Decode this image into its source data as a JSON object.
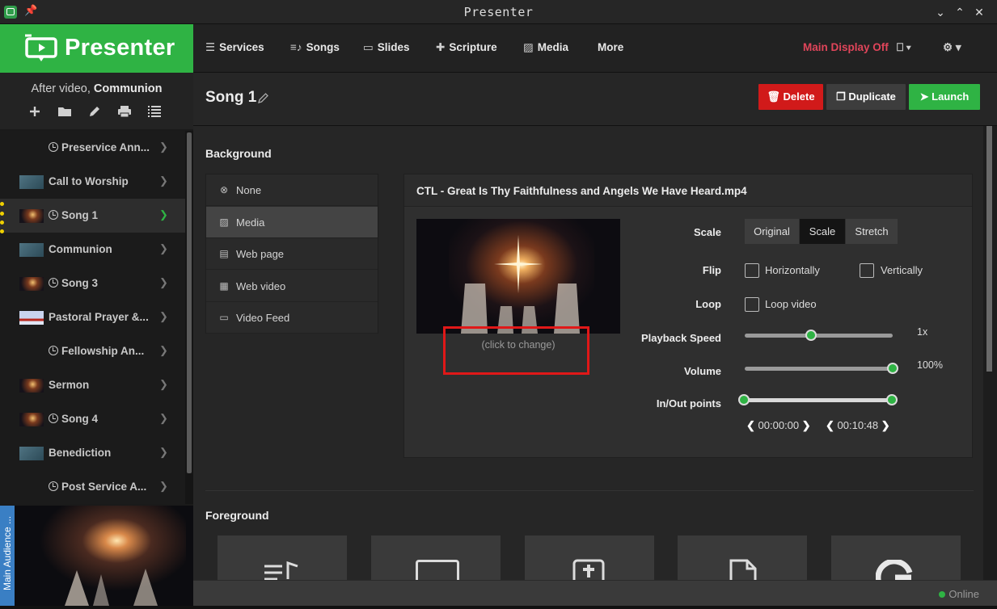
{
  "window": {
    "title": "Presenter",
    "controls": {
      "minimize": "chevron-down-icon",
      "maximize": "chevron-up-icon",
      "close": "close-icon"
    }
  },
  "brand": {
    "name": "Presenter",
    "color": "#2fb344"
  },
  "sidebar": {
    "subtitle_prefix": "After video,",
    "subtitle_current": "Communion",
    "tools": [
      "add-icon",
      "folder-icon",
      "pencil-icon",
      "print-icon",
      "list-icon"
    ],
    "items": [
      {
        "label": "Preservice Ann...",
        "scheduled": true,
        "thumb": "none",
        "active": false
      },
      {
        "label": "Call to Worship",
        "scheduled": false,
        "thumb": "slide",
        "active": false
      },
      {
        "label": "Song 1",
        "scheduled": true,
        "thumb": "video",
        "active": true
      },
      {
        "label": "Communion",
        "scheduled": false,
        "thumb": "slide",
        "active": false
      },
      {
        "label": "Song 3",
        "scheduled": true,
        "thumb": "video",
        "active": false
      },
      {
        "label": "Pastoral Prayer &...",
        "scheduled": false,
        "thumb": "flag",
        "active": false
      },
      {
        "label": "Fellowship An...",
        "scheduled": true,
        "thumb": "none",
        "active": false
      },
      {
        "label": "Sermon",
        "scheduled": false,
        "thumb": "video",
        "active": false
      },
      {
        "label": "Song 4",
        "scheduled": true,
        "thumb": "video",
        "active": false
      },
      {
        "label": "Benediction",
        "scheduled": false,
        "thumb": "slide",
        "active": false
      },
      {
        "label": "Post Service A...",
        "scheduled": true,
        "thumb": "none",
        "active": false
      }
    ],
    "preview_tab": "Main Audience ..."
  },
  "topnav": {
    "items": [
      {
        "label": "Services",
        "icon": "list-icon"
      },
      {
        "label": "Songs",
        "icon": "music-list-icon"
      },
      {
        "label": "Slides",
        "icon": "monitor-icon"
      },
      {
        "label": "Scripture",
        "icon": "bible-icon"
      },
      {
        "label": "Media",
        "icon": "image-icon"
      },
      {
        "label": "More",
        "icon": ""
      }
    ],
    "main_display": "Main Display Off",
    "main_display_color": "#e0455a"
  },
  "song": {
    "title": "Song 1",
    "buttons": {
      "delete": "Delete",
      "duplicate": "Duplicate",
      "launch": "Launch"
    }
  },
  "background": {
    "heading": "Background",
    "options": [
      {
        "label": "None",
        "icon": "circle-x-icon",
        "selected": false
      },
      {
        "label": "Media",
        "icon": "image-icon",
        "selected": true
      },
      {
        "label": "Web page",
        "icon": "browser-icon",
        "selected": false
      },
      {
        "label": "Web video",
        "icon": "film-icon",
        "selected": false
      },
      {
        "label": "Video Feed",
        "icon": "camera-icon",
        "selected": false
      }
    ],
    "media": {
      "filename": "CTL - Great Is Thy Faithfulness and Angels We Have Heard.mp4",
      "click_to_change": "(click to change)",
      "scale_label": "Scale",
      "scale_options": [
        "Original",
        "Scale",
        "Stretch"
      ],
      "scale_selected": "Scale",
      "flip_label": "Flip",
      "flip_h": "Horizontally",
      "flip_v": "Vertically",
      "loop_label": "Loop",
      "loop_text": "Loop video",
      "speed_label": "Playback Speed",
      "speed_value": "1x",
      "speed_fraction": 0.45,
      "volume_label": "Volume",
      "volume_value": "100%",
      "volume_fraction": 1.0,
      "inout_label": "In/Out points",
      "in_time": "00:00:00",
      "out_time": "00:10:48"
    }
  },
  "foreground": {
    "heading": "Foreground",
    "cards": [
      "song-lyrics-icon",
      "slide-icon",
      "scripture-icon",
      "document-icon",
      "google-icon"
    ]
  },
  "status": {
    "online": "Online"
  }
}
